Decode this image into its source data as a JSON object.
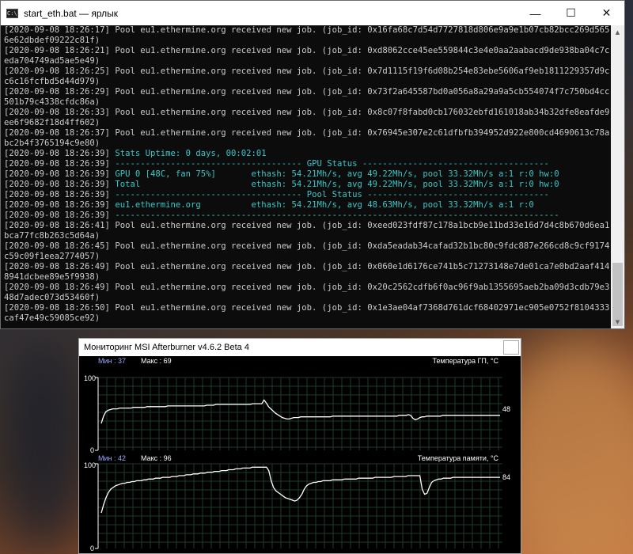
{
  "console": {
    "title": "start_eth.bat — ярлык",
    "icon_text": "C:\\.",
    "buttons": {
      "minimize": "—",
      "maximize": "☐",
      "close": "✕"
    },
    "lines": [
      {
        "text": "[2020-09-08 18:26:17] Pool eu1.ethermine.org received new job. (job_id: 0x16fa68c7d54d7727818d806e9a9e1b07cb82bcc269d565",
        "color": "gray"
      },
      {
        "text": "6e62dbdef09222c81f)",
        "color": "gray"
      },
      {
        "text": "[2020-09-08 18:26:21] Pool eu1.ethermine.org received new job. (job_id: 0xd8062cce45ee559844c3e4e0aa2aabacd9de938ba04c7c",
        "color": "gray"
      },
      {
        "text": "eda704749ad5ae5e49)",
        "color": "gray"
      },
      {
        "text": "[2020-09-08 18:26:25] Pool eu1.ethermine.org received new job. (job_id: 0x7d1115f19f6d08b254e83ebe5606af9eb1811229357d9c",
        "color": "gray"
      },
      {
        "text": "c6c16fcfbd5d44d979)",
        "color": "gray"
      },
      {
        "text": "[2020-09-08 18:26:29] Pool eu1.ethermine.org received new job. (job_id: 0x73f2a645587bd0a056a8a29a9a5cb554074f7c750bd4cc",
        "color": "gray"
      },
      {
        "text": "501b79c4338cfdc86a)",
        "color": "gray"
      },
      {
        "text": "[2020-09-08 18:26:33] Pool eu1.ethermine.org received new job. (job_id: 0x8c07f8fabd0cb176032ebfd161018ab34b32dfe8eafde9",
        "color": "gray"
      },
      {
        "text": "ee6f9682f18d4ff602)",
        "color": "gray"
      },
      {
        "text": "[2020-09-08 18:26:37] Pool eu1.ethermine.org received new job. (job_id: 0x76945e307e2c61dfbfb394952d922e800cd4690613c78a",
        "color": "gray"
      },
      {
        "text": "bc2b4f3765194c9e80)",
        "color": "gray"
      },
      {
        "text": "[2020-09-08 18:26:39] Stats Uptime: 0 days, 00:02:01",
        "color": "mixed",
        "prefix": "[2020-09-08 18:26:39] ",
        "rest": "Stats Uptime: 0 days, 00:02:01"
      },
      {
        "text": "[2020-09-08 18:26:39] ------------------------------------- GPU Status -------------------------------------",
        "color": "mixed",
        "prefix": "[2020-09-08 18:26:39] ",
        "rest": "------------------------------------- GPU Status -------------------------------------"
      },
      {
        "text": "[2020-09-08 18:26:39] GPU 0 [48C, fan 75%]       ethash: 54.21Mh/s, avg 49.22Mh/s, pool 33.32Mh/s a:1 r:0 hw:0",
        "color": "mixed",
        "prefix": "[2020-09-08 18:26:39] ",
        "rest": "GPU 0 [48C, fan 75%]       ethash: 54.21Mh/s, avg 49.22Mh/s, pool 33.32Mh/s a:1 r:0 hw:0"
      },
      {
        "text": "[2020-09-08 18:26:39] Total                      ethash: 54.21Mh/s, avg 49.22Mh/s, pool 33.32Mh/s a:1 r:0 hw:0",
        "color": "mixed",
        "prefix": "[2020-09-08 18:26:39] ",
        "rest": "Total                      ethash: 54.21Mh/s, avg 49.22Mh/s, pool 33.32Mh/s a:1 r:0 hw:0"
      },
      {
        "text": "[2020-09-08 18:26:39] ------------------------------------- Pool Status ------------------------------------",
        "color": "mixed",
        "prefix": "[2020-09-08 18:26:39] ",
        "rest": "------------------------------------- Pool Status ------------------------------------"
      },
      {
        "text": "[2020-09-08 18:26:39] eu1.ethermine.org          ethash: 54.21Mh/s, avg 48.63Mh/s, pool 33.32Mh/s a:1 r:0",
        "color": "mixed",
        "prefix": "[2020-09-08 18:26:39] ",
        "rest": "eu1.ethermine.org          ethash: 54.21Mh/s, avg 48.63Mh/s, pool 33.32Mh/s a:1 r:0"
      },
      {
        "text": "[2020-09-08 18:26:39] ----------------------------------------------------------------------------------------",
        "color": "mixed",
        "prefix": "[2020-09-08 18:26:39] ",
        "rest": "----------------------------------------------------------------------------------------"
      },
      {
        "text": "[2020-09-08 18:26:41] Pool eu1.ethermine.org received new job. (job_id: 0xeed023fdf87c178a1bcb9e11bd33e16d7d4c8b670d6ea1",
        "color": "gray"
      },
      {
        "text": "bca77fc8b263c5d64a)",
        "color": "gray"
      },
      {
        "text": "[2020-09-08 18:26:45] Pool eu1.ethermine.org received new job. (job_id: 0xda5eadab34cafad32b1bc80c9fdc887e266cd8c9cf9174",
        "color": "gray"
      },
      {
        "text": "c59c09f1eea2774057)",
        "color": "gray"
      },
      {
        "text": "[2020-09-08 18:26:49] Pool eu1.ethermine.org received new job. (job_id: 0x060e1d6176ce741b5c71273148e7de01ca7e0bd2aaf414",
        "color": "gray"
      },
      {
        "text": "8941dcbee89e5f9938)",
        "color": "gray"
      },
      {
        "text": "[2020-09-08 18:26:49] Pool eu1.ethermine.org received new job. (job_id: 0x20c2562cdfb6f0ac96f9ab1355695aeb2ba09d3cdb79e3",
        "color": "gray"
      },
      {
        "text": "48d7adec073d53460f)",
        "color": "gray"
      },
      {
        "text": "[2020-09-08 18:26:50] Pool eu1.ethermine.org received new job. (job_id: 0x1e3ae04af7368d761dcf68402971ec905e0752f8104333",
        "color": "gray"
      },
      {
        "text": "caf47e49c59085ce92)",
        "color": "gray"
      }
    ],
    "colors": {
      "gray": "#cccccc",
      "cyan": "#3ac7c7",
      "background": "#0c0c0c"
    }
  },
  "monitor": {
    "title": "Мониторинг MSI Afterburner v4.6.2 Beta 4",
    "colors": {
      "line": "#ffffff",
      "grid": "#1f3a2a",
      "axis": "#ffffff",
      "minmax": "#9aa8ff"
    }
  },
  "chart_data": [
    {
      "type": "line",
      "title": "Температура ГП, °C",
      "min_label": "Мин : 37",
      "max_label": "Макс : 69",
      "current_label": "48",
      "y_top_label": "100",
      "y_bottom_label": "0",
      "ylim": [
        0,
        100
      ],
      "grid": true,
      "series": [
        {
          "values": [
            37,
            47,
            53,
            55,
            56,
            57,
            57,
            57,
            58,
            58,
            58,
            58,
            58,
            58,
            59,
            59,
            59,
            59,
            59,
            59,
            60,
            60,
            60,
            60,
            60,
            60,
            60,
            60,
            60,
            61,
            61,
            61,
            61,
            61,
            61,
            61,
            61,
            61,
            61,
            61,
            61,
            61,
            61,
            61,
            61,
            61,
            62,
            62,
            62,
            62,
            63,
            63,
            63,
            63,
            63,
            63,
            63,
            63,
            63,
            63,
            63,
            63,
            63,
            63,
            63,
            63,
            64,
            64,
            64,
            64,
            64,
            69,
            65,
            60,
            57,
            54,
            51,
            49,
            47,
            45,
            44,
            43,
            43,
            44,
            45,
            45,
            45,
            46,
            46,
            46,
            46,
            46,
            46,
            46,
            46,
            46,
            46,
            46,
            46,
            46,
            46,
            47,
            47,
            47,
            47,
            47,
            47,
            47,
            47,
            47,
            47,
            47,
            47,
            47,
            47,
            47,
            47,
            47,
            47,
            47,
            47,
            47,
            47,
            47,
            47,
            47,
            47,
            47,
            47,
            47,
            48,
            48,
            48,
            48,
            49,
            48,
            44,
            42,
            43,
            45,
            46,
            46,
            47,
            47,
            47,
            47,
            47,
            47,
            47,
            48,
            48,
            48,
            48,
            48,
            48,
            48,
            48,
            48,
            48,
            48,
            48,
            48,
            48,
            48,
            48,
            48,
            48,
            48,
            48,
            48,
            48,
            48,
            48,
            48,
            48
          ]
        }
      ]
    },
    {
      "type": "line",
      "title": "Температура памяти, °C",
      "min_label": "Мин : 42",
      "max_label": "Макс : 96",
      "current_label": "84",
      "y_top_label": "100",
      "y_bottom_label": "0",
      "ylim": [
        0,
        100
      ],
      "grid": true,
      "series": [
        {
          "values": [
            42,
            52,
            60,
            66,
            70,
            72,
            74,
            75,
            76,
            77,
            77,
            78,
            78,
            79,
            79,
            80,
            80,
            80,
            81,
            81,
            82,
            82,
            82,
            83,
            83,
            83,
            84,
            84,
            84,
            84,
            85,
            85,
            85,
            86,
            86,
            86,
            87,
            87,
            87,
            88,
            88,
            88,
            89,
            89,
            89,
            90,
            90,
            90,
            91,
            91,
            91,
            92,
            92,
            92,
            93,
            93,
            93,
            94,
            94,
            94,
            95,
            95,
            95,
            95,
            96,
            96,
            96,
            96,
            96,
            96,
            96,
            92,
            80,
            72,
            68,
            66,
            64,
            62,
            60,
            59,
            58,
            57,
            56,
            57,
            60,
            64,
            70,
            74,
            76,
            77,
            78,
            78,
            79,
            79,
            80,
            80,
            80,
            80,
            81,
            81,
            81,
            81,
            81,
            82,
            82,
            82,
            82,
            82,
            82,
            83,
            83,
            83,
            83,
            83,
            83,
            83,
            84,
            84,
            84,
            84,
            84,
            84,
            84,
            84,
            85,
            85,
            85,
            85,
            85,
            85,
            86,
            86,
            86,
            86,
            86,
            86,
            70,
            64,
            65,
            72,
            78,
            80,
            81,
            82,
            82,
            83,
            83,
            83,
            83,
            84,
            84,
            84,
            84,
            84,
            84,
            84,
            84,
            84,
            84,
            84,
            84,
            84,
            84,
            84,
            84,
            84,
            84,
            84,
            84,
            84
          ]
        }
      ]
    }
  ]
}
